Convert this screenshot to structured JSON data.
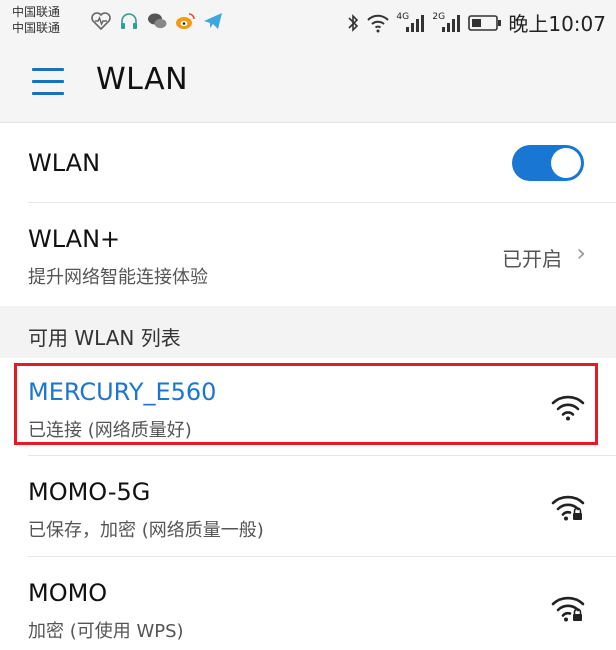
{
  "status_bar": {
    "carrier_1": "中国联通",
    "carrier_2": "中国联通",
    "left_icons": [
      "heart-monitor-icon",
      "headset-icon",
      "wechat-icon",
      "weibo-icon",
      "telegram-icon"
    ],
    "right_icons": [
      "bluetooth-icon",
      "wifi-icon",
      "signal-4g-icon",
      "signal-2g-icon",
      "battery-icon"
    ],
    "lte_label": "4G",
    "second_label": "2G",
    "time": "晚上10:07"
  },
  "app_bar": {
    "title": "WLAN"
  },
  "wlan_toggle": {
    "label": "WLAN",
    "enabled": true
  },
  "wlan_plus": {
    "title": "WLAN+",
    "subtitle": "提升网络智能连接体验",
    "value": "已开启"
  },
  "section": {
    "title": "可用 WLAN 列表"
  },
  "networks": [
    {
      "ssid": "MERCURY_E560",
      "status": "已连接 (网络质量好)",
      "connected": true,
      "locked": false
    },
    {
      "ssid": "MOMO-5G",
      "status": "已保存，加密 (网络质量一般)",
      "connected": false,
      "locked": true
    },
    {
      "ssid": "MOMO",
      "status": "加密 (可使用 WPS)",
      "connected": false,
      "locked": true
    }
  ],
  "colors": {
    "accent": "#1976d2",
    "highlight_border": "#e51a26",
    "background": "#f3f3f3"
  }
}
